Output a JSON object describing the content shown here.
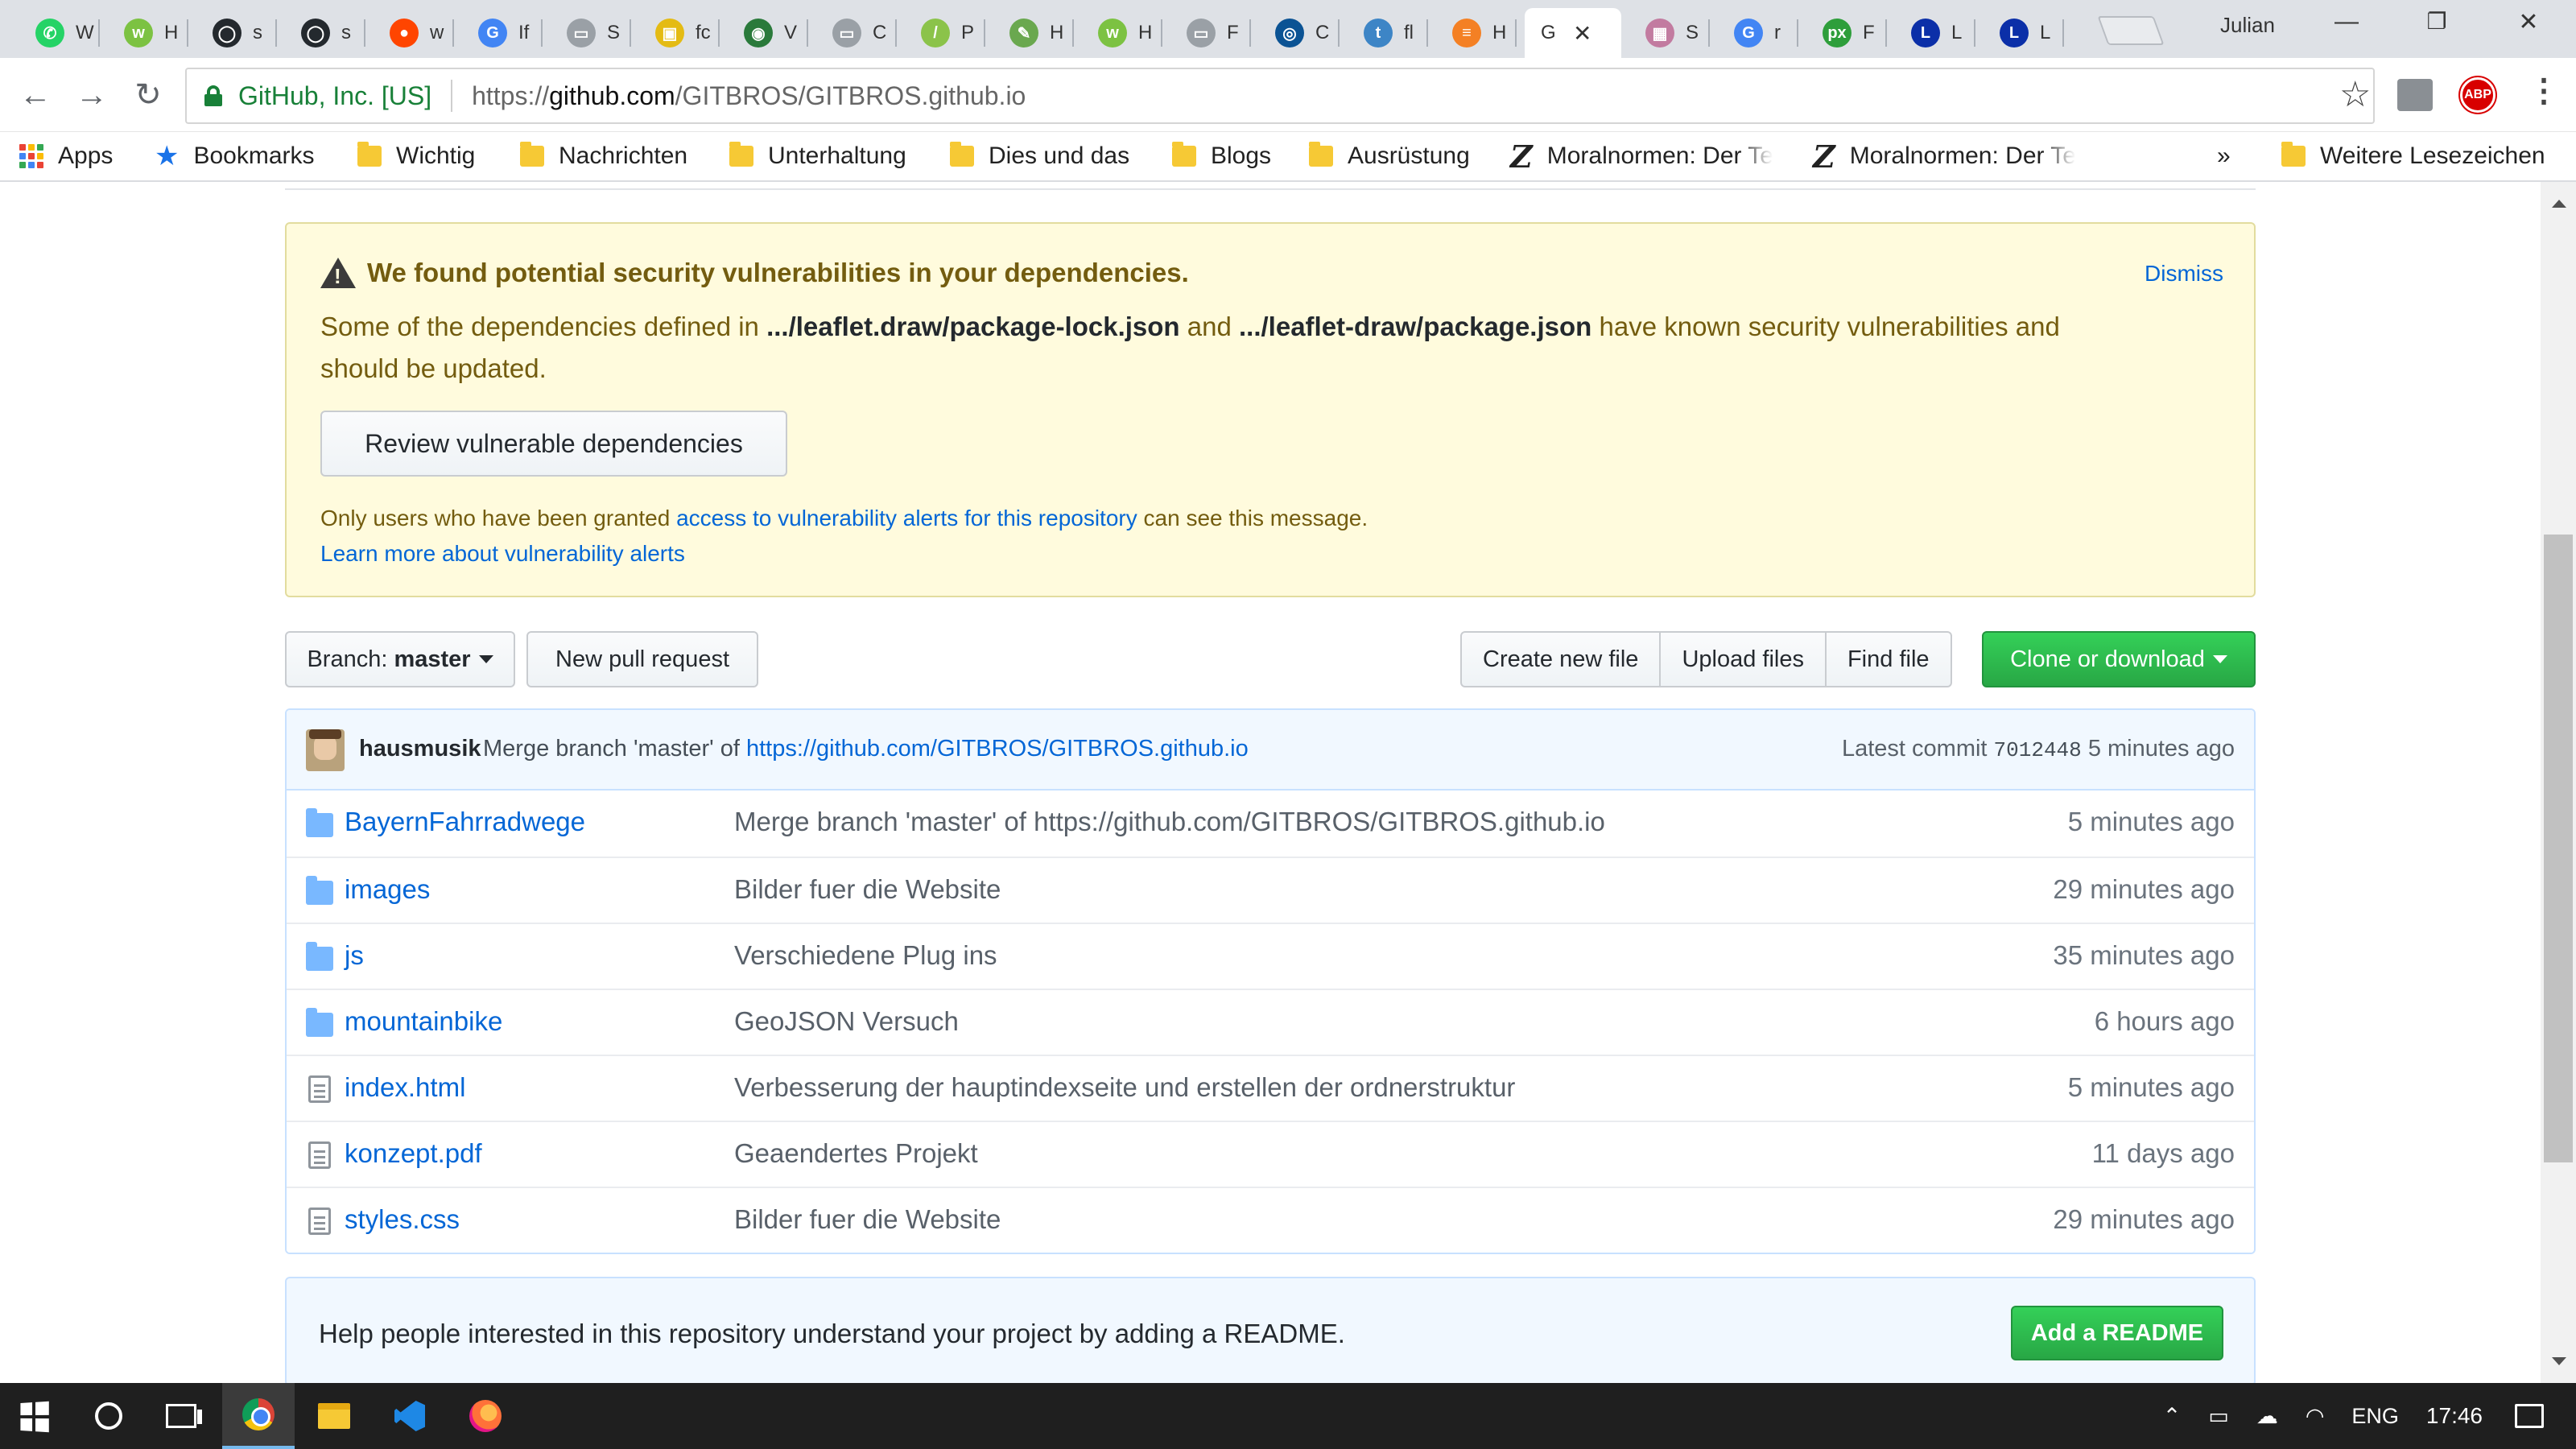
{
  "browser": {
    "tabs": [
      {
        "title": "W",
        "fav_color": "#25d366",
        "fav_glyph": "✆"
      },
      {
        "title": "H",
        "fav_color": "#7cc242",
        "fav_glyph": "w"
      },
      {
        "title": "s",
        "fav_color": "#24292e",
        "fav_glyph": "◯"
      },
      {
        "title": "s",
        "fav_color": "#24292e",
        "fav_glyph": "◯"
      },
      {
        "title": "w",
        "fav_color": "#ff4500",
        "fav_glyph": "●"
      },
      {
        "title": "If",
        "fav_color": "#4285f4",
        "fav_glyph": "G"
      },
      {
        "title": "S",
        "fav_color": "#9aa0a6",
        "fav_glyph": "▭"
      },
      {
        "title": "fc",
        "fav_color": "#e4bb14",
        "fav_glyph": "▣"
      },
      {
        "title": "V",
        "fav_color": "#2a7a3b",
        "fav_glyph": "◉"
      },
      {
        "title": "C",
        "fav_color": "#9aa0a6",
        "fav_glyph": "▭"
      },
      {
        "title": "P",
        "fav_color": "#8bc34a",
        "fav_glyph": "/"
      },
      {
        "title": "H",
        "fav_color": "#6aa84f",
        "fav_glyph": "✎"
      },
      {
        "title": "H",
        "fav_color": "#7cc242",
        "fav_glyph": "w"
      },
      {
        "title": "F",
        "fav_color": "#9aa0a6",
        "fav_glyph": "▭"
      },
      {
        "title": "C",
        "fav_color": "#0b5394",
        "fav_glyph": "◎"
      },
      {
        "title": "fl",
        "fav_color": "#3d85c6",
        "fav_glyph": "t"
      },
      {
        "title": "H",
        "fav_color": "#f48024",
        "fav_glyph": "≡"
      },
      {
        "title": "G",
        "fav_color": "#ffffff",
        "fav_glyph": "",
        "active": true
      },
      {
        "title": "S",
        "fav_color": "#c27ba0",
        "fav_glyph": "▦"
      },
      {
        "title": "r",
        "fav_color": "#4285f4",
        "fav_glyph": "G"
      },
      {
        "title": "F",
        "fav_color": "#2e9e3b",
        "fav_glyph": "px"
      },
      {
        "title": "L",
        "fav_color": "#0b2fa8",
        "fav_glyph": "L"
      },
      {
        "title": "L",
        "fav_color": "#0b2fa8",
        "fav_glyph": "L"
      }
    ],
    "profile_name": "Julian",
    "site_identity": "GitHub, Inc. [US]",
    "url_prefix": "https://",
    "url_host": "github.com",
    "url_path": "/GITBROS/GITBROS.github.io",
    "abp_label": "ABP",
    "bookmarks": [
      {
        "label": "Apps",
        "type": "apps"
      },
      {
        "label": "Bookmarks",
        "type": "star"
      },
      {
        "label": "Wichtig",
        "type": "folder"
      },
      {
        "label": "Nachrichten",
        "type": "folder"
      },
      {
        "label": "Unterhaltung",
        "type": "folder"
      },
      {
        "label": "Dies und das",
        "type": "folder"
      },
      {
        "label": "Blogs",
        "type": "folder"
      },
      {
        "label": "Ausrüstung",
        "type": "folder"
      },
      {
        "label": "Moralnormen: Der Te",
        "type": "z"
      },
      {
        "label": "Moralnormen: Der Te",
        "type": "z"
      }
    ],
    "bookmarks_overflow": "»",
    "other_bookmarks": "Weitere Lesezeichen"
  },
  "alert": {
    "title": "We found potential security vulnerabilities in your dependencies.",
    "dismiss": "Dismiss",
    "body_1": "Some of the dependencies defined in ",
    "file_1": ".../leaflet.draw/package-lock.json",
    "body_2": " and ",
    "file_2": ".../leaflet-draw/package.json",
    "body_3": " have known security vulnerabilities and should be updated.",
    "review_button": "Review vulnerable dependencies",
    "note_1": "Only users who have been granted ",
    "note_link": "access to vulnerability alerts for this repository",
    "note_2": " can see this message.",
    "learn_more": "Learn more about vulnerability alerts"
  },
  "filenav": {
    "branch_prefix": "Branch: ",
    "branch_name": "master",
    "new_pull_request": "New pull request",
    "create_file": "Create new file",
    "upload_files": "Upload files",
    "find_file": "Find file",
    "clone": "Clone or download"
  },
  "commit": {
    "author": "hausmusik",
    "message": "Merge branch 'master' of ",
    "message_link": "https://github.com/GITBROS/GITBROS.github.io",
    "latest_label": "Latest commit ",
    "sha": "7012448",
    "age": " 5 minutes ago"
  },
  "files": [
    {
      "type": "dir",
      "name": "BayernFahrradwege",
      "message": "Merge branch 'master' of https://github.com/GITBROS/GITBROS.github.io",
      "age": "5 minutes ago"
    },
    {
      "type": "dir",
      "name": "images",
      "message": "Bilder fuer die Website",
      "age": "29 minutes ago"
    },
    {
      "type": "dir",
      "name": "js",
      "message": "Verschiedene Plug ins",
      "age": "35 minutes ago"
    },
    {
      "type": "dir",
      "name": "mountainbike",
      "message": "GeoJSON Versuch",
      "age": "6 hours ago"
    },
    {
      "type": "file",
      "name": "index.html",
      "message": "Verbesserung der hauptindexseite und erstellen der ordnerstruktur",
      "age": "5 minutes ago"
    },
    {
      "type": "file",
      "name": "konzept.pdf",
      "message": "Geaendertes Projekt",
      "age": "11 days ago"
    },
    {
      "type": "file",
      "name": "styles.css",
      "message": "Bilder fuer die Website",
      "age": "29 minutes ago"
    }
  ],
  "readme": {
    "text": "Help people interested in this repository understand your project by adding a README.",
    "button": "Add a README"
  },
  "taskbar": {
    "language": "ENG",
    "time": "17:46"
  }
}
